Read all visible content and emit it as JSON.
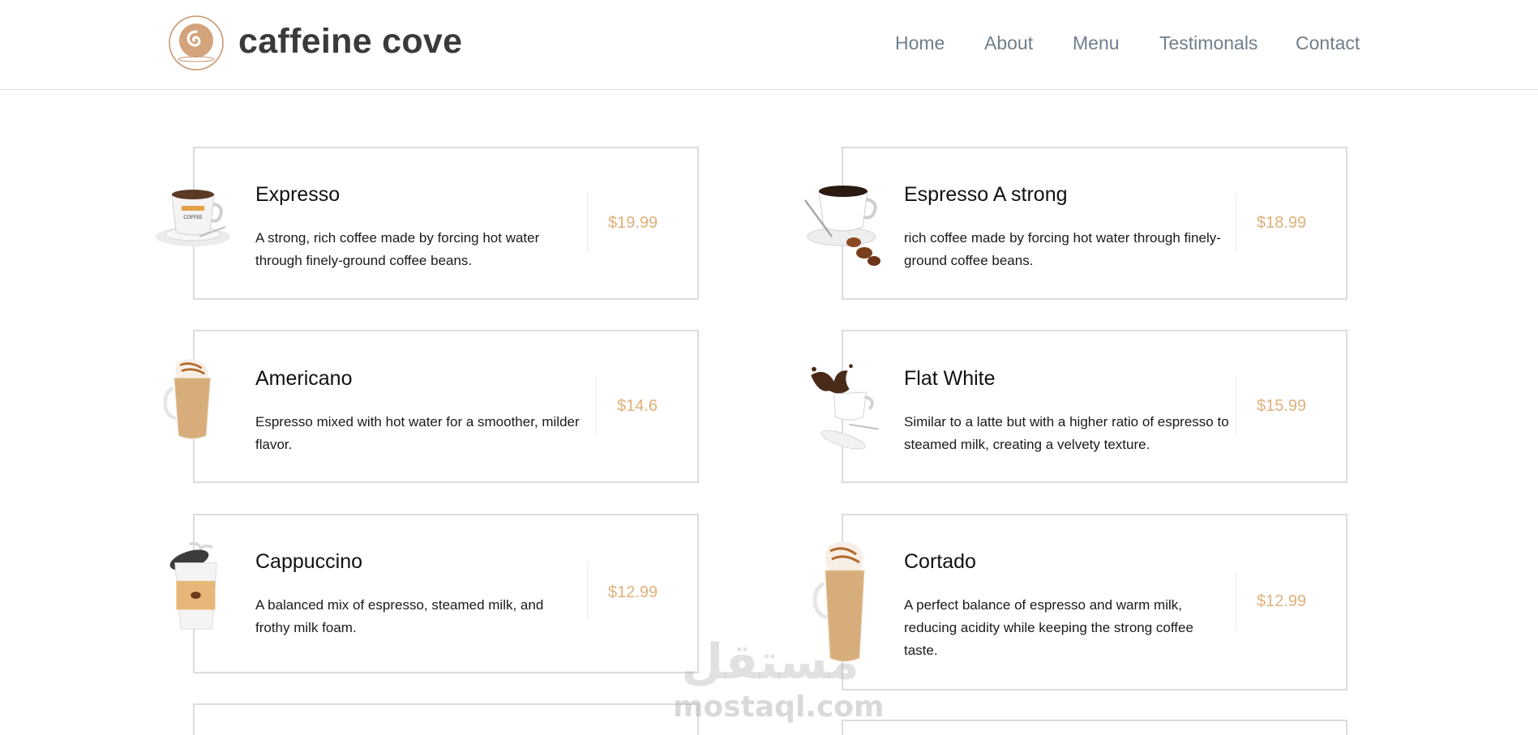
{
  "brand": {
    "name": "caffeine cove",
    "logo_icon": "coffee-swirl-logo-icon",
    "accent": "#c8946a"
  },
  "nav": {
    "home": "Home",
    "about": "About",
    "menu": "Menu",
    "testimonials": "Testimonals",
    "contact": "Contact"
  },
  "menu_items": [
    {
      "name": "Expresso",
      "description": "A strong, rich coffee made by forcing hot water through finely-ground coffee beans.",
      "price": "$19.99",
      "image": "coffee-cup-saucer-icon"
    },
    {
      "name": "Espresso A strong",
      "description": "rich coffee made by forcing hot water through finely-ground coffee beans.",
      "price": "$18.99",
      "image": "espresso-cup-beans-icon"
    },
    {
      "name": "Americano",
      "description": "Espresso mixed with hot water for a smoother, milder flavor.",
      "price": "$14.6",
      "image": "frappe-glass-icon"
    },
    {
      "name": "Flat White",
      "description": "Similar to a latte but with a higher ratio of espresso to steamed milk, creating a velvety texture.",
      "price": "$15.99",
      "image": "splashing-cup-icon"
    },
    {
      "name": "Cappuccino",
      "description": "A balanced mix of espresso, steamed milk, and frothy milk foam.",
      "price": "$12.99",
      "image": "takeaway-cup-icon"
    },
    {
      "name": "Cortado",
      "description": "A perfect balance of espresso and warm milk, reducing acidity while keeping the strong coffee taste.",
      "price": "$12.99",
      "image": "whipped-cream-glass-icon"
    }
  ],
  "colors": {
    "price": "#e0b07a",
    "nav": "#6f7f8c",
    "card_border": "#dcdcdc"
  },
  "watermark": {
    "arabic": "مستقل",
    "latin": "mostaql.com"
  }
}
